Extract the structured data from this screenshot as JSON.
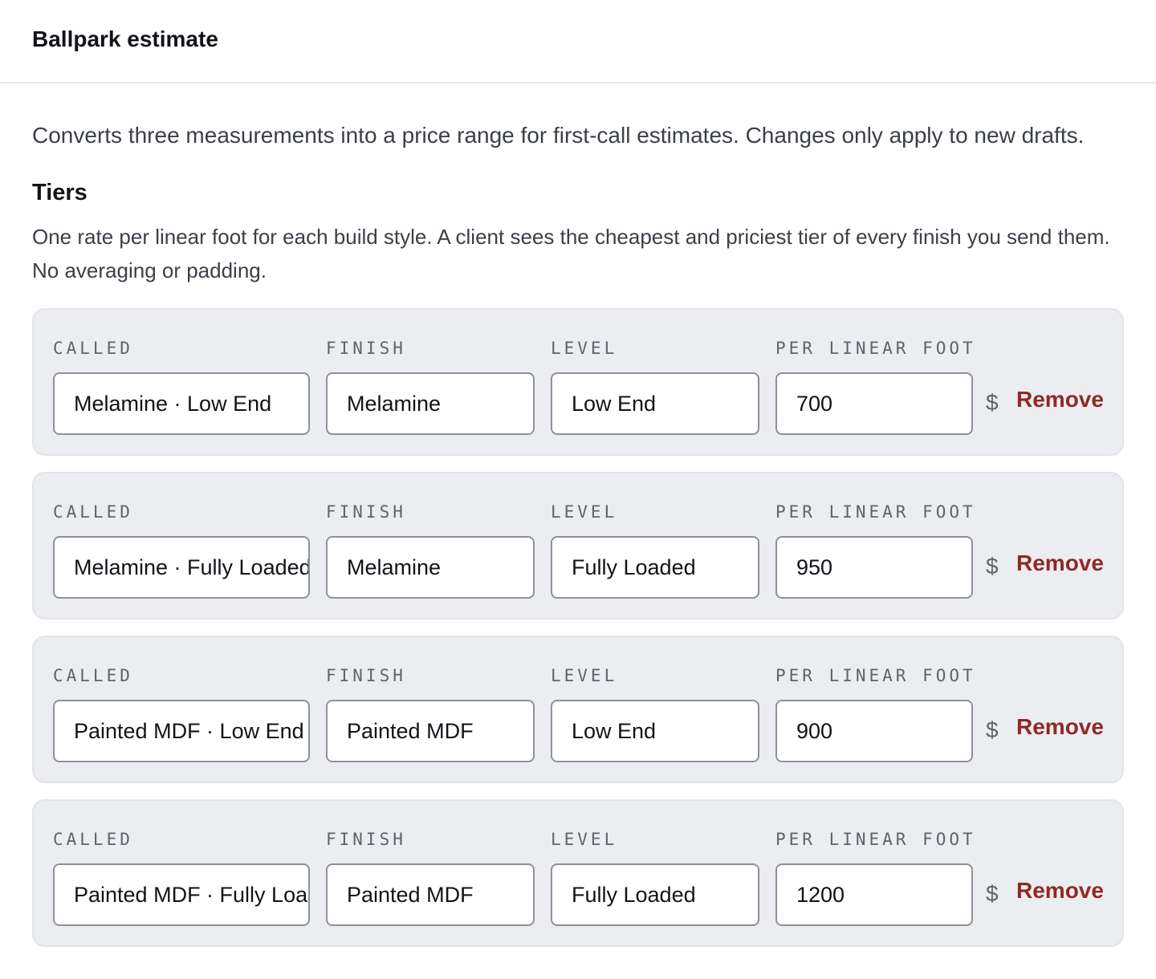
{
  "header": {
    "title": "Ballpark estimate"
  },
  "intro": "Converts three measurements into a price range for first-call estimates. Changes only apply to new drafts.",
  "tiers_section": {
    "title": "Tiers",
    "description": "One rate per linear foot for each build style. A client sees the cheapest and priciest tier of every finish you send them. No averaging or padding.",
    "labels": {
      "called": "CALLED",
      "finish": "FINISH",
      "level": "LEVEL",
      "price": "PER LINEAR FOOT",
      "currency": "$",
      "remove": "Remove"
    },
    "rows": [
      {
        "called": "Melamine · Low End",
        "finish": "Melamine",
        "level": "Low End",
        "price": "700"
      },
      {
        "called": "Melamine · Fully Loaded",
        "finish": "Melamine",
        "level": "Fully Loaded",
        "price": "950"
      },
      {
        "called": "Painted MDF · Low End",
        "finish": "Painted MDF",
        "level": "Low End",
        "price": "900"
      },
      {
        "called": "Painted MDF · Fully Loaded",
        "finish": "Painted MDF",
        "level": "Fully Loaded",
        "price": "1200"
      }
    ]
  },
  "colors": {
    "accent_remove": "#8f2a24",
    "row_background": "#ecedf1",
    "input_border": "#8e9199"
  }
}
